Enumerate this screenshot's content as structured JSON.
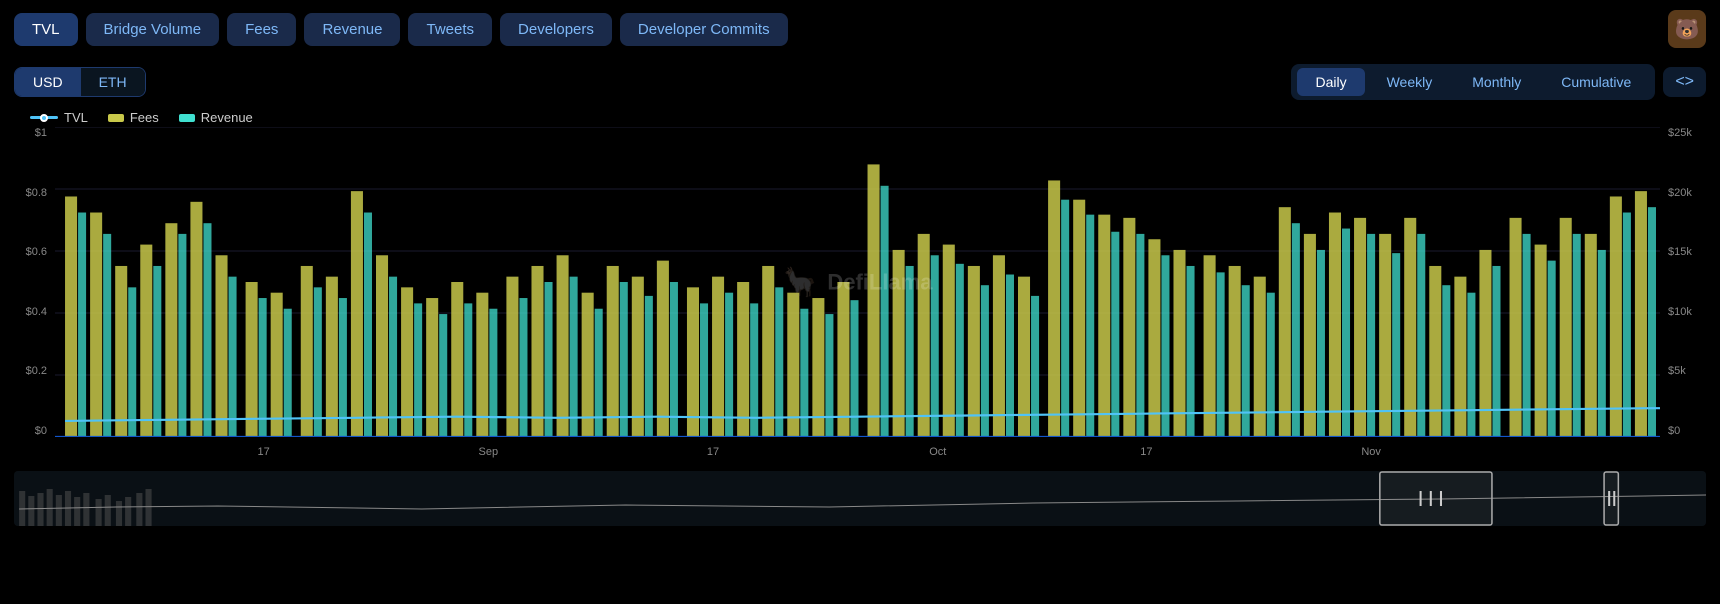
{
  "nav": {
    "buttons": [
      {
        "label": "TVL",
        "active": true
      },
      {
        "label": "Bridge Volume",
        "active": false
      },
      {
        "label": "Fees",
        "active": false
      },
      {
        "label": "Revenue",
        "active": false
      },
      {
        "label": "Tweets",
        "active": false
      },
      {
        "label": "Developers",
        "active": false
      },
      {
        "label": "Developer Commits",
        "active": false
      }
    ]
  },
  "currency": {
    "options": [
      {
        "label": "USD",
        "active": true
      },
      {
        "label": "ETH",
        "active": false
      }
    ]
  },
  "timeframe": {
    "options": [
      {
        "label": "Daily",
        "active": true
      },
      {
        "label": "Weekly",
        "active": false
      },
      {
        "label": "Monthly",
        "active": false
      },
      {
        "label": "Cumulative",
        "active": false
      }
    ]
  },
  "embed_label": "<>",
  "legend": [
    {
      "type": "line",
      "color": "#4fc3f7",
      "label": "TVL"
    },
    {
      "type": "bar",
      "color": "#c8c84a",
      "label": "Fees"
    },
    {
      "type": "bar",
      "color": "#40e0d0",
      "label": "Revenue"
    }
  ],
  "yaxis_left": [
    "$1",
    "$0.8",
    "$0.6",
    "$0.4",
    "$0.2",
    "$0"
  ],
  "yaxis_right": [
    "$25k",
    "$20k",
    "$15k",
    "$10k",
    "$5k",
    "$0"
  ],
  "xaxis_labels": [
    {
      "label": "17",
      "pct": 13
    },
    {
      "label": "Sep",
      "pct": 27
    },
    {
      "label": "17",
      "pct": 41
    },
    {
      "label": "Oct",
      "pct": 55
    },
    {
      "label": "17",
      "pct": 68
    },
    {
      "label": "Nov",
      "pct": 82
    }
  ],
  "watermark": "DefiLlama",
  "chart_title": "Developer Commits"
}
